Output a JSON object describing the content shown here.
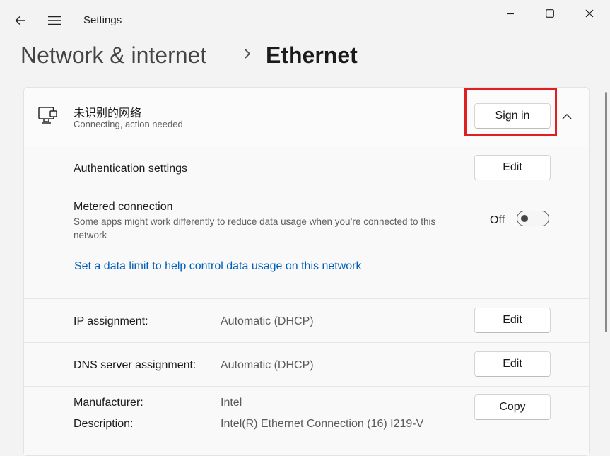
{
  "window": {
    "title": "Settings",
    "back_icon": "arrow-left-icon",
    "menu_icon": "hamburger-icon",
    "controls": [
      "minimize-icon",
      "maximize-icon",
      "close-icon"
    ]
  },
  "breadcrumb": {
    "parent": "Network & internet",
    "current": "Ethernet"
  },
  "network": {
    "name": "未识别的网络",
    "status": "Connecting, action needed",
    "sign_in_label": "Sign in",
    "icon": "ethernet-monitor-icon"
  },
  "rows": {
    "auth_label": "Authentication settings",
    "auth_button": "Edit",
    "metered_label": "Metered connection",
    "metered_desc": "Some apps might work differently to reduce data usage when you’re connected to this network",
    "metered_state": "Off",
    "data_limit_link": "Set a data limit to help control data usage on this network",
    "ip_label": "IP assignment:",
    "ip_value": "Automatic (DHCP)",
    "ip_button": "Edit",
    "dns_label": "DNS server assignment:",
    "dns_value": "Automatic (DHCP)",
    "dns_button": "Edit",
    "manufacturer_label": "Manufacturer:",
    "manufacturer_value": "Intel",
    "description_label": "Description:",
    "description_value": "Intel(R) Ethernet Connection (16) I219-V",
    "copy_button": "Copy"
  },
  "colors": {
    "accent_link": "#005fb8",
    "highlight": "#e02020"
  }
}
